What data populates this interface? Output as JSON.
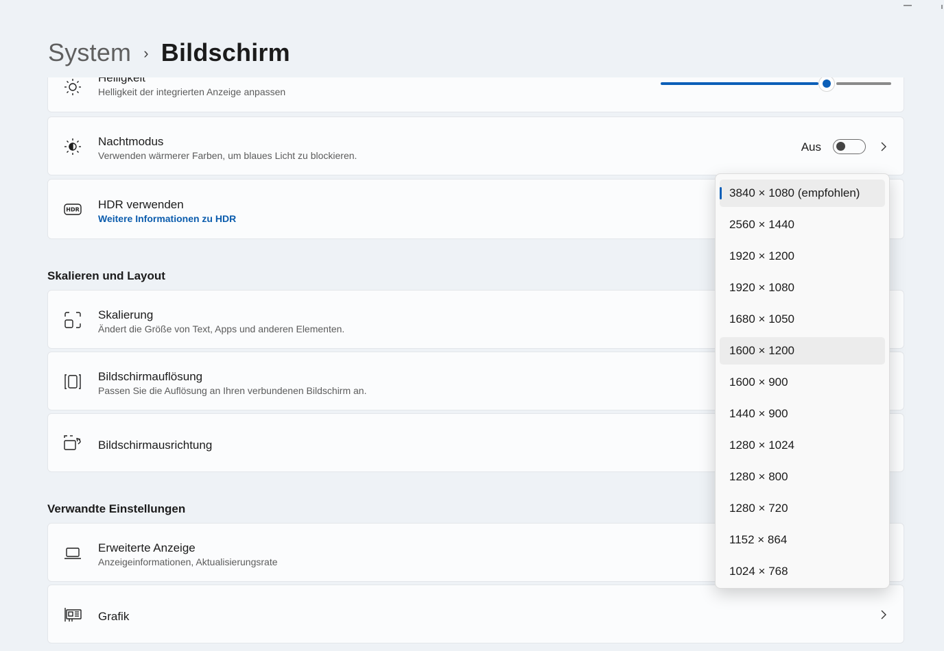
{
  "breadcrumb": {
    "parent": "System",
    "separator": "›",
    "current": "Bildschirm"
  },
  "brightness": {
    "title": "Helligkeit",
    "subtitle": "Helligkeit der integrierten Anzeige anpassen",
    "value_fraction": 0.72
  },
  "night_mode": {
    "title": "Nachtmodus",
    "subtitle": "Verwenden wärmerer Farben, um blaues Licht zu blockieren.",
    "toggle_label": "Aus"
  },
  "hdr": {
    "title": "HDR verwenden",
    "link": "Weitere Informationen zu HDR",
    "icon_text": "HDR"
  },
  "section_scale": "Skalieren und Layout",
  "scaling": {
    "title": "Skalierung",
    "subtitle": "Ändert die Größe von Text, Apps und anderen Elementen."
  },
  "resolution": {
    "title": "Bildschirmauflösung",
    "subtitle": "Passen Sie die Auflösung an Ihren verbundenen Bildschirm an."
  },
  "orientation": {
    "title": "Bildschirmausrichtung"
  },
  "section_related": "Verwandte Einstellungen",
  "advanced_display": {
    "title": "Erweiterte Anzeige",
    "subtitle": "Anzeigeinformationen, Aktualisierungsrate"
  },
  "graphics": {
    "title": "Grafik"
  },
  "resolution_options": [
    "3840 × 1080 (empfohlen)",
    "2560 × 1440",
    "1920 × 1200",
    "1920 × 1080",
    "1680 × 1050",
    "1600 × 1200",
    "1600 × 900",
    "1440 × 900",
    "1280 × 1024",
    "1280 × 800",
    "1280 × 720",
    "1152 × 864",
    "1024 × 768"
  ],
  "selected_index": 0,
  "hover_index": 5,
  "colors": {
    "accent": "#0c5fb8",
    "link": "#0b5cad"
  }
}
